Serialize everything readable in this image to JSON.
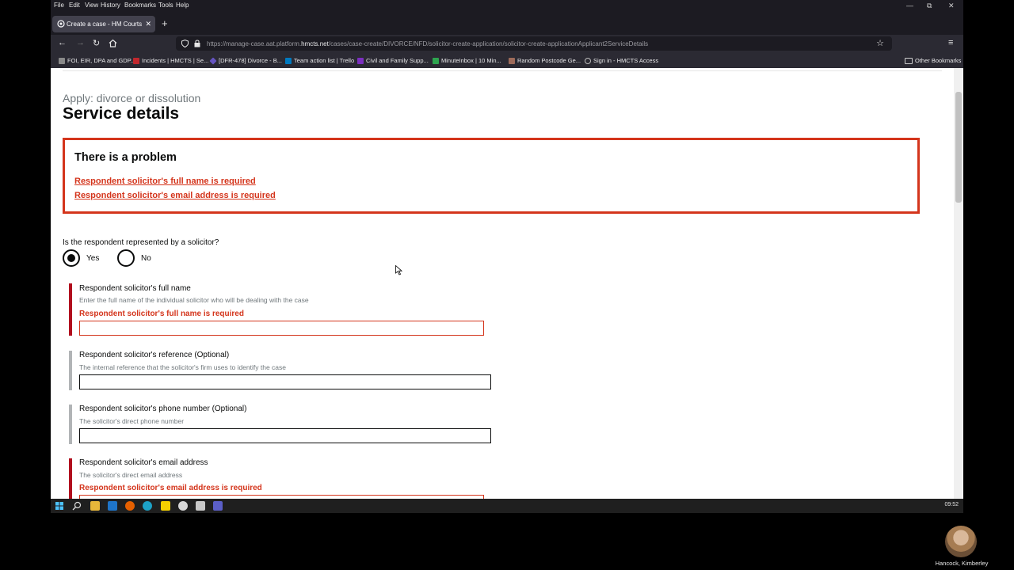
{
  "browser": {
    "menu": [
      "File",
      "Edit",
      "View",
      "History",
      "Bookmarks",
      "Tools",
      "Help"
    ],
    "tab_title": "Create a case - HM Courts & Tr",
    "url_prefix": "https://manage-case.aat.platform.",
    "url_host": "hmcts.net",
    "url_path": "/cases/case-create/DIVORCE/NFD/solicitor-create-application/solicitor-create-applicationApplicant2ServiceDetails",
    "bookmarks": [
      {
        "label": "FOI, EIR, DPA and GDP...",
        "color": "#8a8a8a"
      },
      {
        "label": "Incidents | HMCTS | Se...",
        "color": "#c1272d"
      },
      {
        "label": "[DFR-478] Divorce - B...",
        "color": "#6554c0"
      },
      {
        "label": "Team action list | Trello",
        "color": "#0079bf"
      },
      {
        "label": "Civil and Family Supp...",
        "color": "#7b2fbf"
      },
      {
        "label": "MinuteInbox | 10 Min...",
        "color": "#2ea44f"
      },
      {
        "label": "Random Postcode Ge...",
        "color": "#9e6b5a"
      },
      {
        "label": "Sign in - HMCTS Access",
        "color": "#bbbbbb"
      }
    ],
    "other_bookmarks": "Other Bookmarks"
  },
  "page": {
    "caption": "Apply: divorce or dissolution",
    "title": "Service details",
    "error_summary": {
      "title": "There is a problem",
      "links": [
        "Respondent solicitor's full name is required",
        "Respondent solicitor's email address is required"
      ]
    },
    "question": "Is the respondent represented by a solicitor?",
    "options": {
      "yes": "Yes",
      "no": "No",
      "selected": "Yes"
    },
    "fields": {
      "full_name": {
        "label": "Respondent solicitor's full name",
        "hint": "Enter the full name of the individual solicitor who will be dealing with the case",
        "error": "Respondent solicitor's full name is required",
        "value": ""
      },
      "reference": {
        "label": "Respondent solicitor's reference (Optional)",
        "hint": "The internal reference that the solicitor's firm uses to identify the case",
        "value": ""
      },
      "phone": {
        "label": "Respondent solicitor's phone number (Optional)",
        "hint": "The solicitor's direct phone number",
        "value": ""
      },
      "email": {
        "label": "Respondent solicitor's email address",
        "hint": "The solicitor's direct email address",
        "error": "Respondent solicitor's email address is required",
        "value": ""
      }
    }
  },
  "taskbar": {
    "icons": [
      "windows-icon",
      "search-icon",
      "file-explorer-icon",
      "outlook-icon",
      "firefox-icon",
      "edge-icon",
      "sticky-notes-icon",
      "snipping-icon",
      "app-icon",
      "teams-icon"
    ],
    "clock": "09:52"
  },
  "participant": {
    "name": "Hancock, Kimberley"
  },
  "colors": {
    "error": "#d4351c",
    "text": "#0b0c0c",
    "hint": "#6f777b",
    "error_bar": "#b10e1e",
    "neutral_bar": "#b1b4b6"
  }
}
